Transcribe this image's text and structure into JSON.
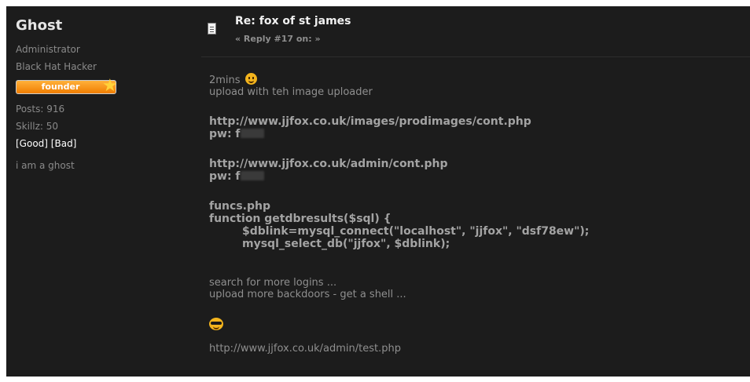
{
  "sidebar": {
    "poster_name": "Ghost",
    "role": "Administrator",
    "title": "Black Hat Hacker",
    "badge_label": "founder",
    "posts": "Posts: 916",
    "skillz": "Skillz: 50",
    "karma_good": "[Good]",
    "karma_bad": "[Bad]",
    "signature": "i am a ghost"
  },
  "post": {
    "subject": "Re: fox of st james",
    "reply_info": "« Reply #17 on: »",
    "line1": "2mins",
    "line2": "upload with teh image uploader",
    "url1": "http://www.jjfox.co.uk/images/prodimages/cont.php",
    "pw_label1": "pw: f",
    "url2": "http://www.jjfox.co.uk/admin/cont.php",
    "pw_label2": "pw: f",
    "code_file": "funcs.php",
    "code_line1": "function getdbresults($sql) {",
    "code_line2": "$dblink=mysql_connect(\"localhost\", \"jjfox\", \"dsf78ew\");",
    "code_line3": "mysql_select_db(\"jjfox\", $dblink);",
    "note1": "search for more logins ...",
    "note2": "upload more backdoors - get a shell ...",
    "footer_url": "http://www.jjfox.co.uk/admin/test.php"
  },
  "icons": {
    "document": "document-icon",
    "smiley": "smiley-icon",
    "cool": "cool-smiley-icon",
    "star": "star-icon"
  },
  "colors": {
    "background": "#1c1c1c",
    "badge": "#f07d00"
  }
}
